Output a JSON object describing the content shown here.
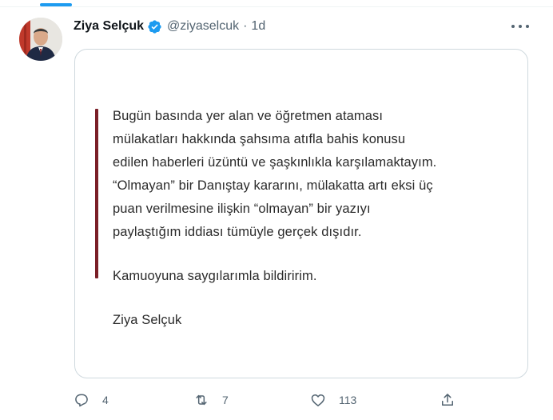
{
  "tweet": {
    "author": {
      "display_name": "Ziya Selçuk",
      "handle": "@ziyaselcuk",
      "verified": true
    },
    "separator": "·",
    "time": "1d",
    "image_text": {
      "paragraph_1": [
        "Bugün basında yer alan ve öğretmen ataması",
        "mülakatları hakkında şahsıma atıfla bahis konusu",
        "edilen haberleri üzüntü ve şaşkınlıkla karşılamaktayım.",
        "“Olmayan” bir Danıştay kararını, mülakatta artı eksi üç",
        "puan verilmesine ilişkin “olmayan” bir yazıyı",
        "paylaştığım iddiası tümüyle gerçek dışıdır."
      ],
      "closing": "Kamuoyuna saygılarımla bildiririm.",
      "signature": "Ziya Selçuk"
    },
    "actions": {
      "replies": "4",
      "retweets": "7",
      "likes": "113"
    }
  },
  "colors": {
    "accent": "#1d9bf0",
    "quote_bar": "#7a1f27",
    "muted_text": "#536471"
  },
  "icons": [
    "verified-badge-icon",
    "more-options-icon",
    "reply-icon",
    "retweet-icon",
    "like-icon",
    "share-icon"
  ]
}
